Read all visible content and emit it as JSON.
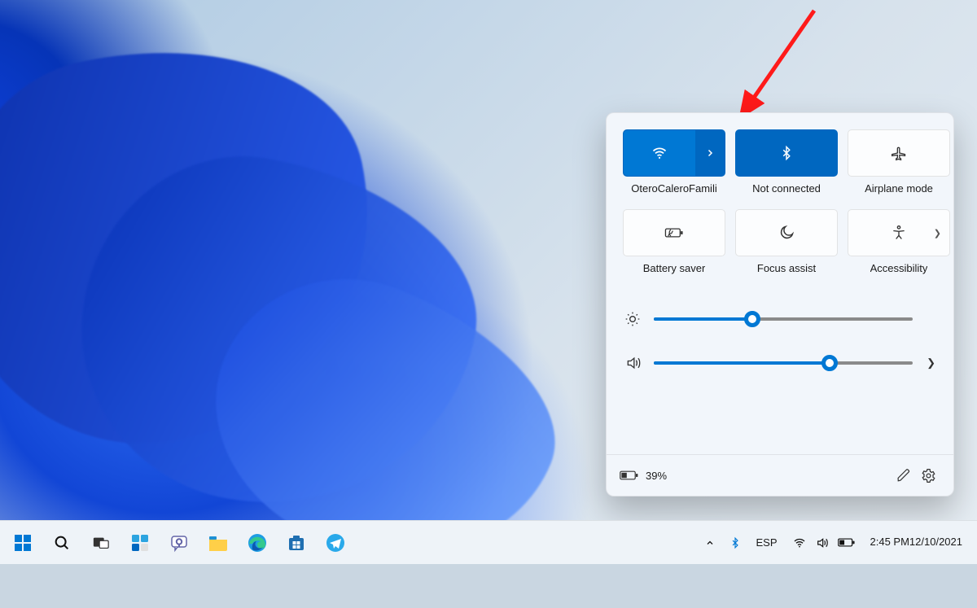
{
  "quick_settings": {
    "tiles": [
      {
        "label": "OteroCaleroFamili",
        "icon": "wifi-icon",
        "active": true,
        "split": true
      },
      {
        "label": "Not connected",
        "icon": "bluetooth-icon",
        "active": true,
        "split": false
      },
      {
        "label": "Airplane mode",
        "icon": "airplane-icon",
        "active": false,
        "split": false
      },
      {
        "label": "Battery saver",
        "icon": "battery-saver-icon",
        "active": false,
        "split": false
      },
      {
        "label": "Focus assist",
        "icon": "moon-icon",
        "active": false,
        "split": false
      },
      {
        "label": "Accessibility",
        "icon": "accessibility-icon",
        "active": false,
        "split": false,
        "chevron": true
      }
    ],
    "brightness_percent": 38,
    "volume_percent": 68,
    "battery_text": "39%"
  },
  "taskbar": {
    "apps": [
      "start-icon",
      "search-icon",
      "task-view-icon",
      "widgets-icon",
      "chat-icon",
      "file-explorer-icon",
      "edge-icon",
      "store-icon",
      "telegram-icon"
    ],
    "tray": {
      "lang": "ESP",
      "time": "2:45 PM",
      "date": "12/10/2021"
    }
  },
  "colors": {
    "accent": "#0078d4",
    "accent_dark": "#0067c0"
  }
}
